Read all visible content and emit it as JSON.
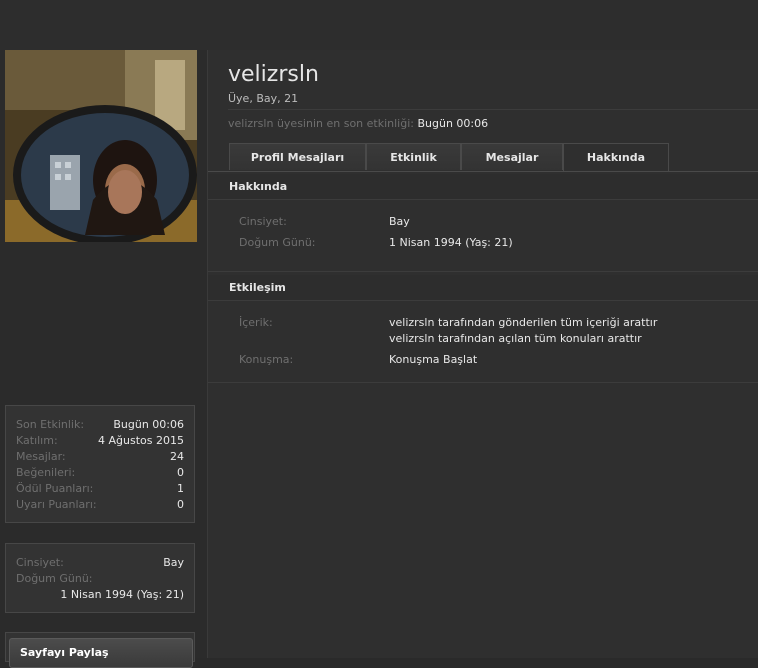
{
  "profile": {
    "username": "velizrsln",
    "subtitle": "Üye, Bay, 21",
    "activity_label": "velizrsln üyesinin en son etkinliği:",
    "activity_value": "Bugün 00:06"
  },
  "tabs": [
    {
      "label": "Profil Mesajları"
    },
    {
      "label": "Etkinlik"
    },
    {
      "label": "Mesajlar"
    },
    {
      "label": "Hakkında"
    }
  ],
  "about": {
    "title": "Hakkında",
    "rows": [
      {
        "label": "Cinsiyet:",
        "value": "Bay"
      },
      {
        "label": "Doğum Günü:",
        "value": "1 Nisan 1994 (Yaş: 21)"
      }
    ]
  },
  "interaction": {
    "title": "Etkileşim",
    "content_label": "İçerik:",
    "content_links": [
      "velizrsln tarafından gönderilen tüm içeriği arattır",
      "velizrsln tarafından açılan tüm konuları arattır"
    ],
    "conversation_label": "Konuşma:",
    "conversation_link": "Konuşma Başlat"
  },
  "stats": [
    {
      "label": "Son Etkinlik:",
      "value": "Bugün 00:06"
    },
    {
      "label": "Katılım:",
      "value": "4 Ağustos 2015"
    },
    {
      "label": "Mesajlar:",
      "value": "24"
    },
    {
      "label": "Beğenileri:",
      "value": "0"
    },
    {
      "label": "Ödül Puanları:",
      "value": "1"
    },
    {
      "label": "Uyarı Puanları:",
      "value": "0"
    }
  ],
  "info": {
    "gender_label": "Cinsiyet:",
    "gender_value": "Bay",
    "birthday_label": "Doğum Günü:",
    "birthday_value": "1 Nisan 1994 (Yaş: 21)"
  },
  "share": {
    "label": "Sayfayı Paylaş"
  }
}
